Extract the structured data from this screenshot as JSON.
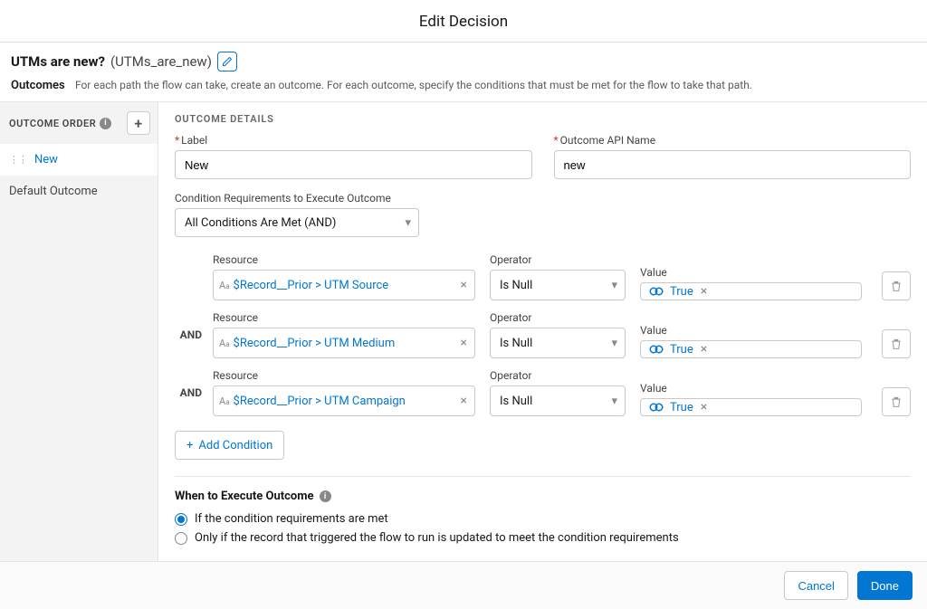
{
  "header": {
    "title": "Edit Decision"
  },
  "decision": {
    "label": "UTMs are new?",
    "api_name": "(UTMs_are_new)"
  },
  "outcomes_section": {
    "label": "Outcomes",
    "description": "For each path the flow can take, create an outcome. For each outcome, specify the conditions that must be met for the flow to take that path."
  },
  "sidebar": {
    "title": "OUTCOME ORDER",
    "items": [
      {
        "label": "New",
        "active": true
      },
      {
        "label": "Default Outcome",
        "active": false
      }
    ]
  },
  "details": {
    "section_title": "OUTCOME DETAILS",
    "label_field": {
      "label": "Label",
      "value": "New"
    },
    "api_field": {
      "label": "Outcome API Name",
      "value": "new"
    },
    "logic_label": "Condition Requirements to Execute Outcome",
    "logic_value": "All Conditions Are Met (AND)",
    "col_resource": "Resource",
    "col_operator": "Operator",
    "col_value": "Value",
    "logic_word": "AND",
    "conditions": [
      {
        "resource": "$Record__Prior > UTM Source",
        "operator": "Is Null",
        "value": "True"
      },
      {
        "resource": "$Record__Prior > UTM Medium",
        "operator": "Is Null",
        "value": "True"
      },
      {
        "resource": "$Record__Prior > UTM Campaign",
        "operator": "Is Null",
        "value": "True"
      }
    ],
    "add_condition": "Add Condition",
    "execute": {
      "title": "When to Execute Outcome",
      "opt1": "If the condition requirements are met",
      "opt2": "Only if the record that triggered the flow to run is updated to meet the condition requirements"
    }
  },
  "footer": {
    "cancel": "Cancel",
    "done": "Done"
  }
}
